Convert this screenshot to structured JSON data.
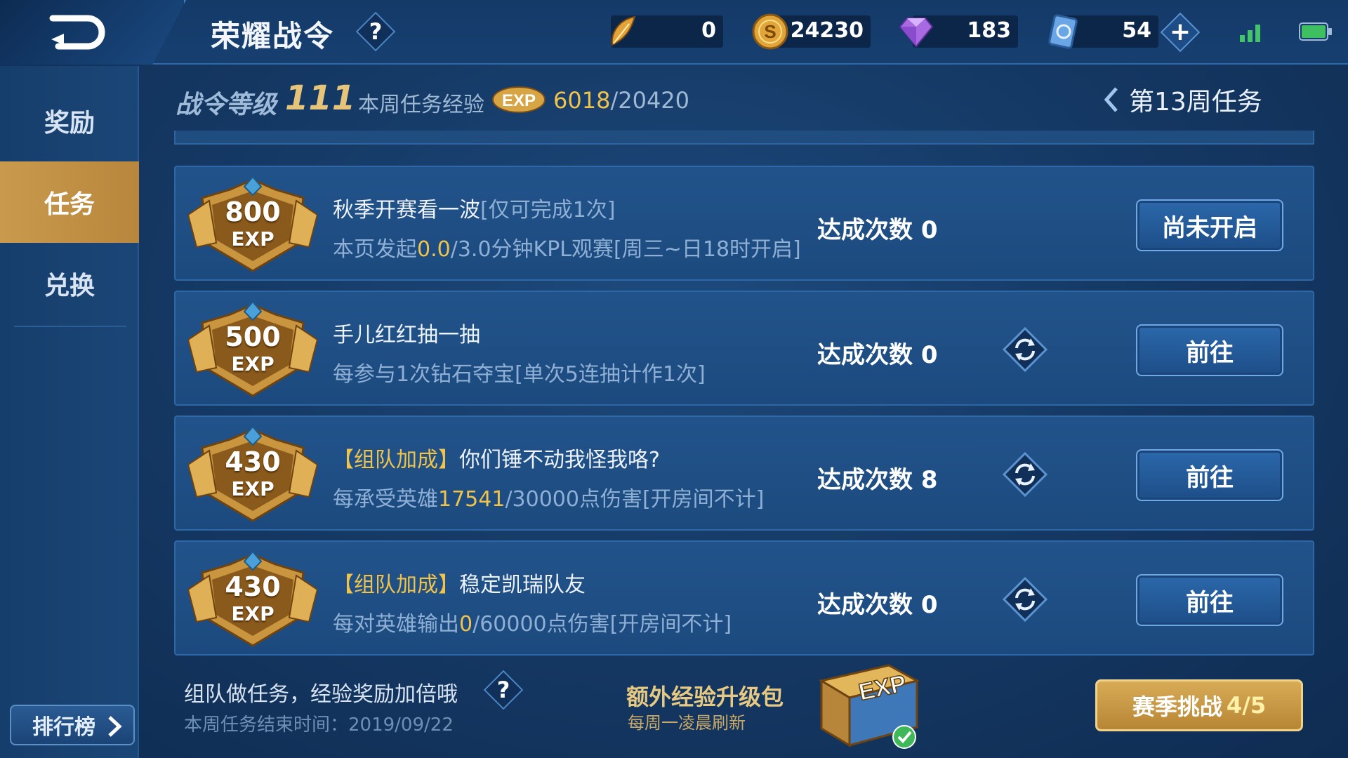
{
  "header": {
    "title": "荣耀战令",
    "help_label": "?"
  },
  "currencies": [
    {
      "name": "feather",
      "icon": "feather-icon",
      "value": "0"
    },
    {
      "name": "gold",
      "icon": "gold-coin-icon",
      "value": "24230"
    },
    {
      "name": "diamond",
      "icon": "diamond-icon",
      "value": "183"
    },
    {
      "name": "voucher",
      "icon": "voucher-icon",
      "value": "54"
    }
  ],
  "add_label": "+",
  "sidebar": {
    "items": [
      {
        "label": "奖励",
        "active": false
      },
      {
        "label": "任务",
        "active": true
      },
      {
        "label": "兑换",
        "active": false
      }
    ],
    "rank_label": "排行榜"
  },
  "progress": {
    "level_label": "战令等级",
    "level": "111",
    "weekly_label": "本周任务经验",
    "exp_badge": "EXP",
    "current": "6018",
    "total": "/20420"
  },
  "week_nav": "第13周任务",
  "tasks": [
    {
      "exp": "800",
      "exp_unit": "EXP",
      "tag": "",
      "name": "秋季开赛看一波",
      "note": "[仅可完成1次]",
      "desc_pre": "本页发起",
      "desc_hl": "0.0",
      "desc_post": "/3.0分钟KPL观赛[周三~日18时开启]",
      "count_label": "达成次数",
      "count": "0",
      "refresh": false,
      "button": "尚未开启"
    },
    {
      "exp": "500",
      "exp_unit": "EXP",
      "tag": "",
      "name": "手儿红红抽一抽",
      "note": "",
      "desc_pre": "每参与1次钻石夺宝[单次5连抽计作1次]",
      "desc_hl": "",
      "desc_post": "",
      "count_label": "达成次数",
      "count": "0",
      "refresh": true,
      "button": "前往"
    },
    {
      "exp": "430",
      "exp_unit": "EXP",
      "tag": "【组队加成】",
      "name": "你们锤不动我怪我咯?",
      "note": "",
      "desc_pre": "每承受英雄",
      "desc_hl": "17541",
      "desc_post": "/30000点伤害[开房间不计]",
      "count_label": "达成次数",
      "count": "8",
      "refresh": true,
      "button": "前往"
    },
    {
      "exp": "430",
      "exp_unit": "EXP",
      "tag": "【组队加成】",
      "name": "稳定凯瑞队友",
      "note": "",
      "desc_pre": "每对英雄输出",
      "desc_hl": "0",
      "desc_post": "/60000点伤害[开房间不计]",
      "count_label": "达成次数",
      "count": "0",
      "refresh": true,
      "button": "前往"
    }
  ],
  "footer": {
    "tip": "组队做任务，经验奖励加倍哦",
    "end_time": "本周任务结束时间：2019/09/22",
    "pack_title": "额外经验升级包",
    "pack_sub": "每周一凌晨刷新",
    "pack_badge": "EXP",
    "season_label": "赛季挑战",
    "season_progress": "4/5"
  },
  "colors": {
    "accent_gold": "#f0c34a",
    "active_tab": "#c99a4d",
    "panel": "#21538a"
  }
}
